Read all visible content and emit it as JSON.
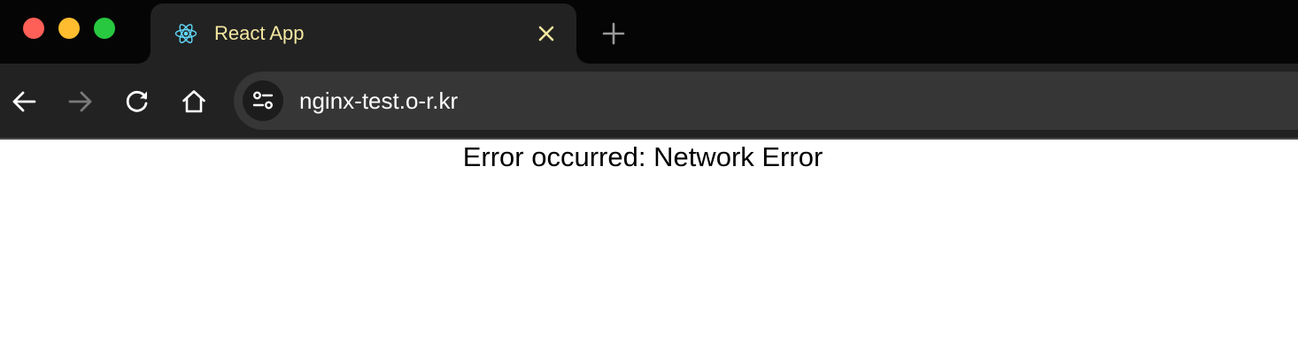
{
  "tab": {
    "title": "React App",
    "favicon_icon": "react-logo-icon",
    "title_color": "#f4e7a1"
  },
  "toolbar": {
    "back_icon": "arrow-left-icon",
    "forward_icon": "arrow-right-icon",
    "reload_icon": "reload-icon",
    "home_icon": "home-icon",
    "site_info_icon": "tune-icon"
  },
  "address_bar": {
    "url": "nginx-test.o-r.kr"
  },
  "page": {
    "message": "Error occurred: Network Error"
  },
  "colors": {
    "traffic_close": "#fe5f57",
    "traffic_minimize": "#febc2e",
    "traffic_maximize": "#28c840",
    "react_blue": "#61dafb"
  }
}
